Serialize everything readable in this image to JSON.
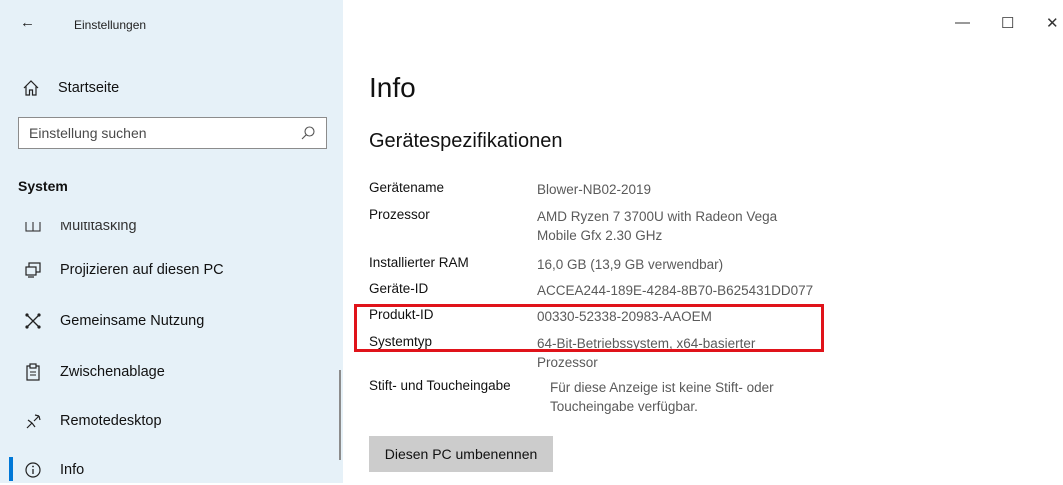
{
  "window": {
    "title": "Einstellungen",
    "controls": {
      "minimize": "—",
      "maximize": "☐",
      "close": "✕"
    }
  },
  "sidebar": {
    "back_icon": "←",
    "home": {
      "label": "Startseite",
      "icon": "home-icon"
    },
    "search": {
      "placeholder": "Einstellung suchen",
      "value": "",
      "icon": "search-icon"
    },
    "section": "System",
    "items": [
      {
        "label": "Multitasking",
        "icon": "multitasking-icon",
        "partial": true
      },
      {
        "label": "Projizieren auf diesen PC",
        "icon": "project-icon"
      },
      {
        "label": "Gemeinsame Nutzung",
        "icon": "share-icon"
      },
      {
        "label": "Zwischenablage",
        "icon": "clipboard-icon"
      },
      {
        "label": "Remotedesktop",
        "icon": "remote-desktop-icon"
      },
      {
        "label": "Info",
        "icon": "info-icon",
        "active": true
      }
    ]
  },
  "main": {
    "title": "Info",
    "subtitle": "Gerätespezifikationen",
    "specs": [
      {
        "key": "Gerätename",
        "value": "Blower-NB02-2019"
      },
      {
        "key": "Prozessor",
        "value": "AMD Ryzen 7 3700U with Radeon Vega Mobile Gfx 2.30 GHz"
      },
      {
        "key": "Installierter RAM",
        "value": "16,0 GB (13,9 GB verwendbar)"
      },
      {
        "key": "Geräte-ID",
        "value": "ACCEA244-189E-4284-8B70-B625431DD077"
      },
      {
        "key": "Produkt-ID",
        "value": "00330-52338-20983-AAOEM"
      },
      {
        "key": "Systemtyp",
        "value": "64-Bit-Betriebssystem, x64-basierter Prozessor"
      },
      {
        "key": "Stift- und Toucheingabe",
        "value": "Für diese Anzeige ist keine Stift- oder Toucheingabe verfügbar."
      }
    ],
    "rename_button": "Diesen PC umbenennen"
  },
  "colors": {
    "sidebar_bg": "#e6f1f8",
    "accent": "#0078d7",
    "highlight_border": "#e0131a",
    "button_bg": "#cccccc"
  }
}
